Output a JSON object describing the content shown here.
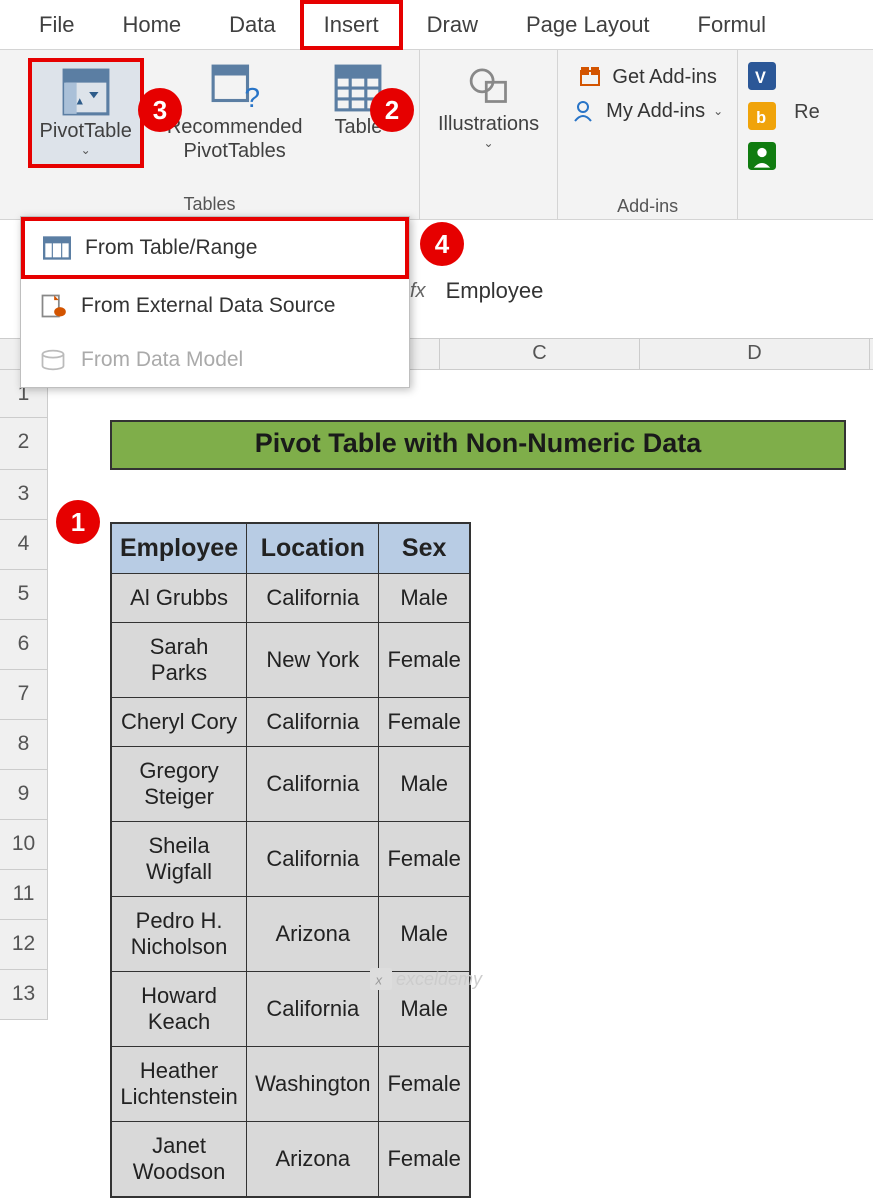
{
  "tabs": {
    "file": "File",
    "home": "Home",
    "data": "Data",
    "insert": "Insert",
    "draw": "Draw",
    "pagelayout": "Page Layout",
    "formulas": "Formul"
  },
  "ribbon": {
    "pivottable": "PivotTable",
    "recommended": "Recommended\nPivotTables",
    "table": "Table",
    "illustrations": "Illustrations",
    "tables_group": "Tables",
    "addins": {
      "get": "Get Add-ins",
      "my": "My Add-ins",
      "group": "Add-ins"
    },
    "re": "Re"
  },
  "dropdown": {
    "from_table": "From Table/Range",
    "from_external": "From External Data Source",
    "from_model": "From Data Model"
  },
  "formula_bar": {
    "fx": "fx",
    "value": "Employee"
  },
  "columns": {
    "c": "C",
    "d": "D"
  },
  "rows": [
    "1",
    "2",
    "3",
    "4",
    "5",
    "6",
    "7",
    "8",
    "9",
    "10",
    "11",
    "12",
    "13"
  ],
  "sheet_title": "Pivot Table with Non-Numeric Data",
  "table": {
    "headers": {
      "emp": "Employee",
      "loc": "Location",
      "sex": "Sex"
    },
    "rows": [
      {
        "emp": "Al Grubbs",
        "loc": "California",
        "sex": "Male"
      },
      {
        "emp": "Sarah Parks",
        "loc": "New York",
        "sex": "Female"
      },
      {
        "emp": "Cheryl Cory",
        "loc": "California",
        "sex": "Female"
      },
      {
        "emp": "Gregory Steiger",
        "loc": "California",
        "sex": "Male"
      },
      {
        "emp": "Sheila Wigfall",
        "loc": "California",
        "sex": "Female"
      },
      {
        "emp": "Pedro H. Nicholson",
        "loc": "Arizona",
        "sex": "Male"
      },
      {
        "emp": "Howard Keach",
        "loc": "California",
        "sex": "Male"
      },
      {
        "emp": "Heather Lichtenstein",
        "loc": "Washington",
        "sex": "Female"
      },
      {
        "emp": "Janet Woodson",
        "loc": "Arizona",
        "sex": "Female"
      }
    ]
  },
  "badges": {
    "b1": "1",
    "b2": "2",
    "b3": "3",
    "b4": "4"
  },
  "watermark": "exceldemy"
}
